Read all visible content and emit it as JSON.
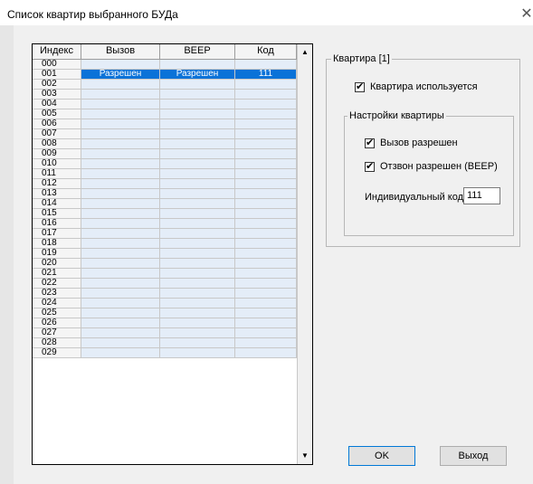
{
  "window": {
    "title": "Список квартир выбранного БУДа",
    "close_glyph": "✕"
  },
  "table": {
    "headers": [
      "Индекс",
      "Вызов",
      "BEEP",
      "Код"
    ],
    "rows": [
      {
        "idx": "000",
        "call": "",
        "beep": "",
        "code": ""
      },
      {
        "idx": "001",
        "call": "Разрешен",
        "beep": "Разрешен",
        "code": "111",
        "selected": true
      },
      {
        "idx": "002",
        "call": "",
        "beep": "",
        "code": ""
      },
      {
        "idx": "003",
        "call": "",
        "beep": "",
        "code": ""
      },
      {
        "idx": "004",
        "call": "",
        "beep": "",
        "code": ""
      },
      {
        "idx": "005",
        "call": "",
        "beep": "",
        "code": ""
      },
      {
        "idx": "006",
        "call": "",
        "beep": "",
        "code": ""
      },
      {
        "idx": "007",
        "call": "",
        "beep": "",
        "code": ""
      },
      {
        "idx": "008",
        "call": "",
        "beep": "",
        "code": ""
      },
      {
        "idx": "009",
        "call": "",
        "beep": "",
        "code": ""
      },
      {
        "idx": "010",
        "call": "",
        "beep": "",
        "code": ""
      },
      {
        "idx": "011",
        "call": "",
        "beep": "",
        "code": ""
      },
      {
        "idx": "012",
        "call": "",
        "beep": "",
        "code": ""
      },
      {
        "idx": "013",
        "call": "",
        "beep": "",
        "code": ""
      },
      {
        "idx": "014",
        "call": "",
        "beep": "",
        "code": ""
      },
      {
        "idx": "015",
        "call": "",
        "beep": "",
        "code": ""
      },
      {
        "idx": "016",
        "call": "",
        "beep": "",
        "code": ""
      },
      {
        "idx": "017",
        "call": "",
        "beep": "",
        "code": ""
      },
      {
        "idx": "018",
        "call": "",
        "beep": "",
        "code": ""
      },
      {
        "idx": "019",
        "call": "",
        "beep": "",
        "code": ""
      },
      {
        "idx": "020",
        "call": "",
        "beep": "",
        "code": ""
      },
      {
        "idx": "021",
        "call": "",
        "beep": "",
        "code": ""
      },
      {
        "idx": "022",
        "call": "",
        "beep": "",
        "code": ""
      },
      {
        "idx": "023",
        "call": "",
        "beep": "",
        "code": ""
      },
      {
        "idx": "024",
        "call": "",
        "beep": "",
        "code": ""
      },
      {
        "idx": "025",
        "call": "",
        "beep": "",
        "code": ""
      },
      {
        "idx": "026",
        "call": "",
        "beep": "",
        "code": ""
      },
      {
        "idx": "027",
        "call": "",
        "beep": "",
        "code": ""
      },
      {
        "idx": "028",
        "call": "",
        "beep": "",
        "code": ""
      },
      {
        "idx": "029",
        "call": "",
        "beep": "",
        "code": ""
      }
    ],
    "selection_color": "#0a72d8"
  },
  "scrollbar": {
    "up_glyph": "▲",
    "down_glyph": "▼"
  },
  "apartment_group": {
    "legend": "Квартира [1]",
    "used_checkbox": {
      "label": "Квартира используется",
      "checked": true
    },
    "settings_group": {
      "legend": "Настройки квартиры",
      "call_checkbox": {
        "label": "Вызов разрешен",
        "checked": true
      },
      "beep_checkbox": {
        "label": "Отзвон разрешен (BEEP)",
        "checked": true
      },
      "code_label": "Индивидуальный код",
      "code_value": "111"
    }
  },
  "buttons": {
    "ok": "OK",
    "exit": "Выход"
  }
}
